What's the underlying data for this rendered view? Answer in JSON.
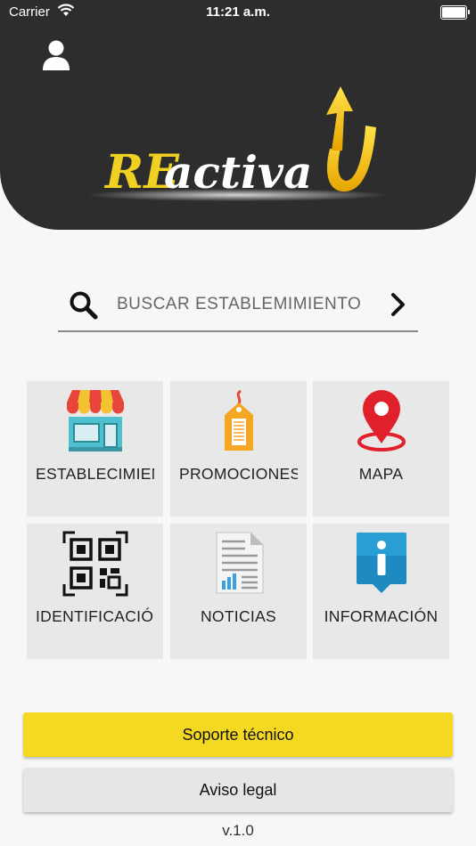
{
  "status_bar": {
    "carrier": "Carrier",
    "time": "11:21 a.m.",
    "icons": [
      "wifi-icon",
      "battery-icon"
    ]
  },
  "header": {
    "profile_icon": "user-icon",
    "logo_text_prefix": "RE",
    "logo_text_main": "activa"
  },
  "search": {
    "placeholder": "BUSCAR ESTABLEMIMIENTO",
    "icon": "search-icon",
    "go_icon": "chevron-right-icon"
  },
  "tiles": [
    {
      "label": "ESTABLECIMIENTOS",
      "icon": "store-icon"
    },
    {
      "label": "PROMOCIONES",
      "icon": "price-tag-icon"
    },
    {
      "label": "MAPA",
      "icon": "map-pin-icon"
    },
    {
      "label": "IDENTIFICACIÓN",
      "icon": "qr-code-icon"
    },
    {
      "label": "NOTICIAS",
      "icon": "news-document-icon"
    },
    {
      "label": "INFORMACIÓN",
      "icon": "info-icon"
    }
  ],
  "buttons": {
    "support": "Soporte técnico",
    "legal": "Aviso legal"
  },
  "version": "v.1.0",
  "colors": {
    "header": "#2d2d2d",
    "accent_yellow": "#f5d821",
    "tile_bg": "#e8e8e8"
  }
}
